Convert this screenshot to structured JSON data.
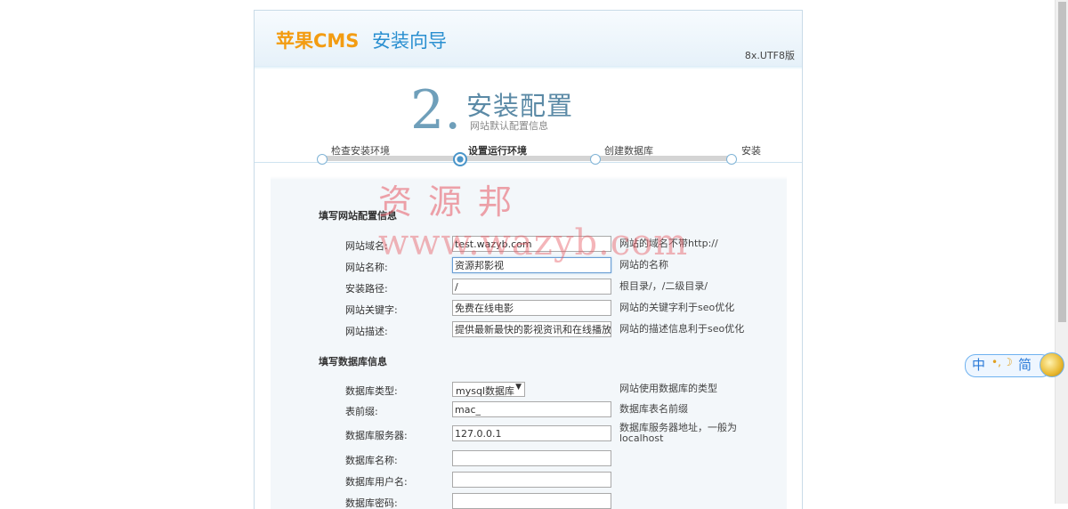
{
  "header": {
    "brand": "苹果CMS",
    "wizard": "安装向导",
    "version": "8x.UTF8版"
  },
  "step": {
    "number": "2.",
    "title": "安装配置",
    "subtitle": "网站默认配置信息"
  },
  "progress": {
    "steps": [
      "检查安装环境",
      "设置运行环境",
      "创建数据库",
      "安装"
    ],
    "current_index": 1
  },
  "watermark": {
    "line1": "资源邦",
    "line2": "www.wazyb.com"
  },
  "site_section": {
    "title": "填写网站配置信息",
    "fields": [
      {
        "label": "网站域名:",
        "value": "test.wazyb.com",
        "hint": "网站的域名不带http://"
      },
      {
        "label": "网站名称:",
        "value": "资源邦影视",
        "hint": "网站的名称"
      },
      {
        "label": "安装路径:",
        "value": "/",
        "hint": "根目录/，/二级目录/"
      },
      {
        "label": "网站关键字:",
        "value": "免费在线电影",
        "hint": "网站的关键字利于seo优化"
      },
      {
        "label": "网站描述:",
        "value": "提供最新最快的影视资讯和在线播放",
        "hint": "网站的描述信息利于seo优化"
      }
    ]
  },
  "db_section": {
    "title": "填写数据库信息",
    "type": {
      "label": "数据库类型:",
      "value": "mysql数据库",
      "hint": "网站使用数据库的类型"
    },
    "fields": [
      {
        "label": "表前缀:",
        "value": "mac_",
        "hint": "数据库表名前缀"
      },
      {
        "label": "数据库服务器:",
        "value": "127.0.0.1",
        "hint": "数据库服务器地址，一般为localhost"
      },
      {
        "label": "数据库名称:",
        "value": "",
        "hint": ""
      },
      {
        "label": "数据库用户名:",
        "value": "",
        "hint": ""
      },
      {
        "label": "数据库密码:",
        "value": "",
        "hint": ""
      }
    ]
  },
  "ime": {
    "lang": "中",
    "mode": "简"
  }
}
